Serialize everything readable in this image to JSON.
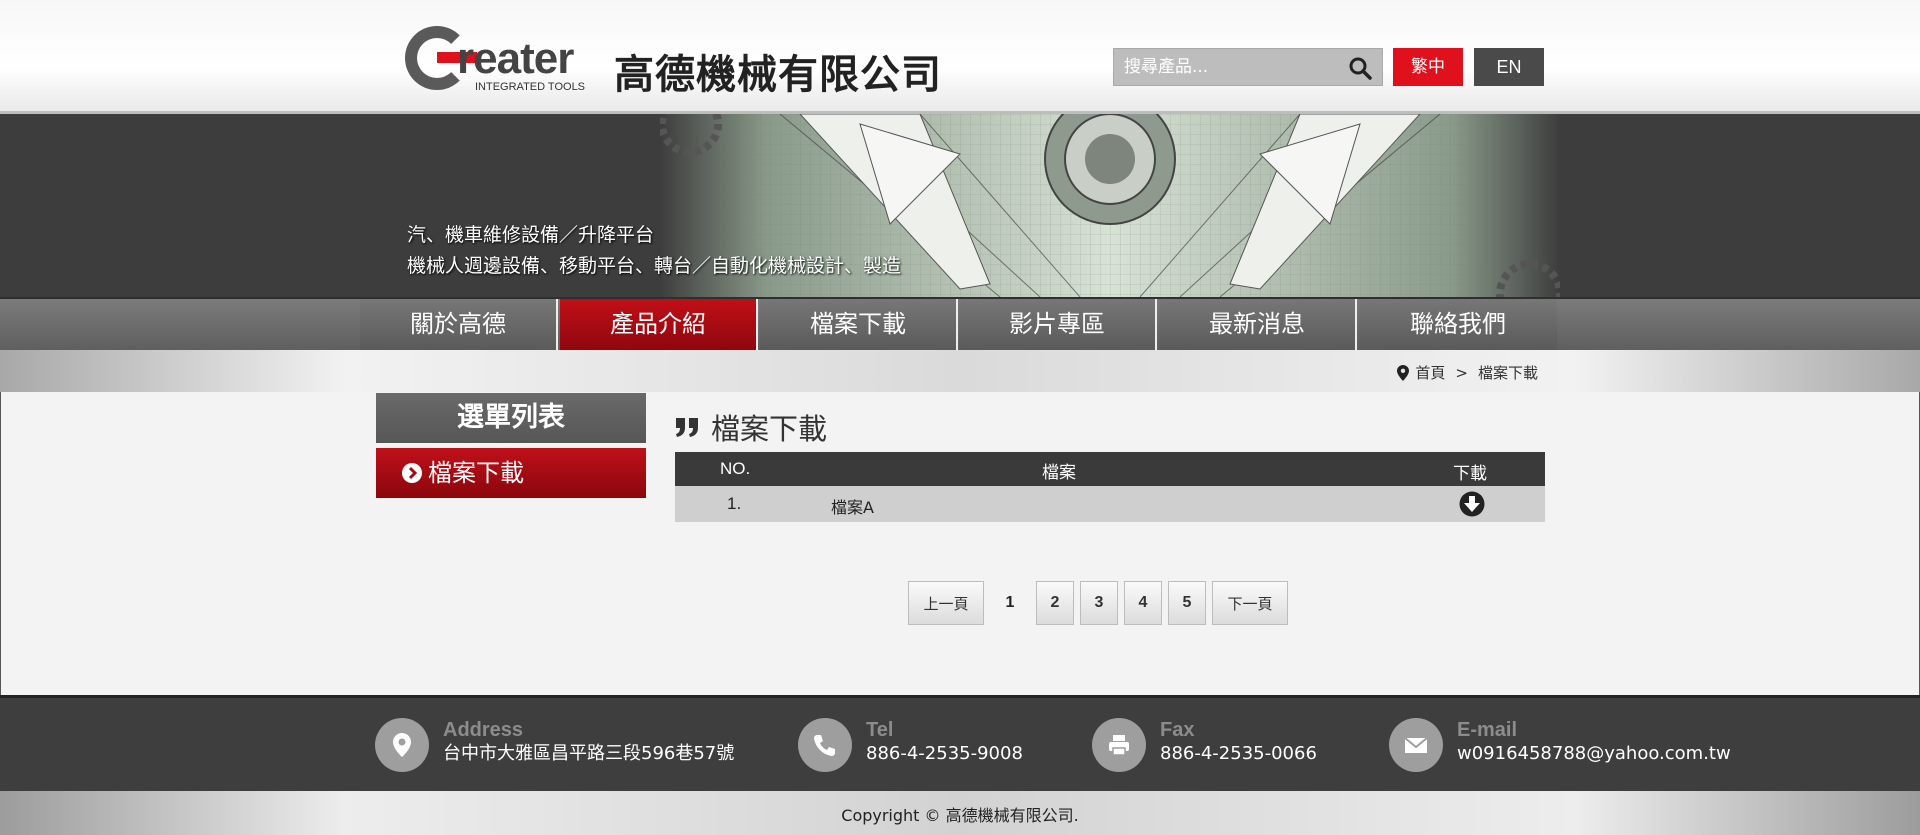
{
  "header": {
    "logo_word": "reater",
    "logo_sub": "INTEGRATED TOOLS",
    "company_name": "高德機械有限公司",
    "search_placeholder": "搜尋產品...",
    "lang_zh": "繁中",
    "lang_en": "EN"
  },
  "banner": {
    "line1": "汽、機車維修設備／升降平台",
    "line2": "機械人週邊設備、移動平台、轉台／自動化機械設計、製造"
  },
  "nav": {
    "items": [
      {
        "label": "關於高德"
      },
      {
        "label": "產品介紹"
      },
      {
        "label": "檔案下載"
      },
      {
        "label": "影片專區"
      },
      {
        "label": "最新消息"
      },
      {
        "label": "聯絡我們"
      }
    ]
  },
  "breadcrumb": {
    "home": "首頁",
    "separator": ">",
    "current": "檔案下載"
  },
  "sidebar": {
    "title": "選單列表",
    "items": [
      {
        "label": "檔案下載"
      }
    ]
  },
  "content": {
    "title": "檔案下載",
    "table": {
      "headers": {
        "no": "NO.",
        "file": "檔案",
        "download": "下載"
      },
      "rows": [
        {
          "no": "1.",
          "file": "檔案A"
        }
      ]
    },
    "pagination": {
      "prev": "上一頁",
      "current": "1",
      "pages": [
        "2",
        "3",
        "4",
        "5"
      ],
      "next": "下一頁"
    }
  },
  "footer": {
    "address": {
      "label": "Address",
      "value": "台中市大雅區昌平路三段596巷57號"
    },
    "tel": {
      "label": "Tel",
      "value": "886-4-2535-9008"
    },
    "fax": {
      "label": "Fax",
      "value": "886-4-2535-0066"
    },
    "email": {
      "label": "E-mail",
      "value": "w0916458788@yahoo.com.tw"
    },
    "copyright": "Copyright © 高德機械有限公司."
  },
  "colors": {
    "accent_red": "#e0101d",
    "dark": "#3e3e3e"
  }
}
